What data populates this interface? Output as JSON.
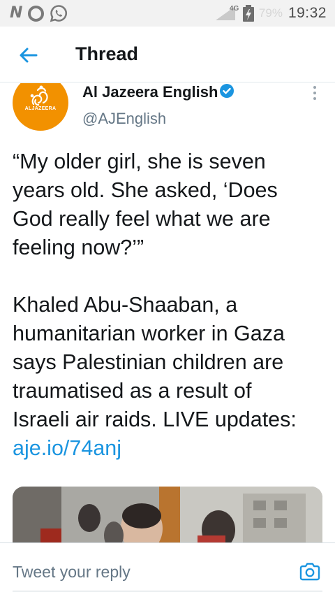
{
  "status_bar": {
    "network": "4G",
    "battery_percent": "79%",
    "time": "19:32",
    "left_icons": [
      "n-icon",
      "opera-icon",
      "whatsapp-icon"
    ]
  },
  "header": {
    "title": "Thread",
    "back_icon": "arrow-left-icon"
  },
  "tweet": {
    "author_name": "Al Jazeera English",
    "author_handle": "@AJEnglish",
    "avatar_text": "ALJAZEERA",
    "verified": true,
    "text_lines": [
      "“My older girl, she is seven",
      "years old. She asked, ‘Does",
      "God really feel what we are",
      "feeling now?’”",
      "Khaled Abu-Shaaban, a",
      "humanitarian worker in Gaza",
      "says Palestinian children are",
      "traumatised as a result of",
      "Israeli air raids. LIVE updates:"
    ],
    "link": "aje.io/74anj"
  },
  "reply_bar": {
    "placeholder": "Tweet your reply",
    "camera_icon": "camera-icon"
  },
  "colors": {
    "accent": "#1b95e0",
    "brand_orange": "#f29100",
    "text_primary": "#14171a",
    "text_secondary": "#657786"
  }
}
